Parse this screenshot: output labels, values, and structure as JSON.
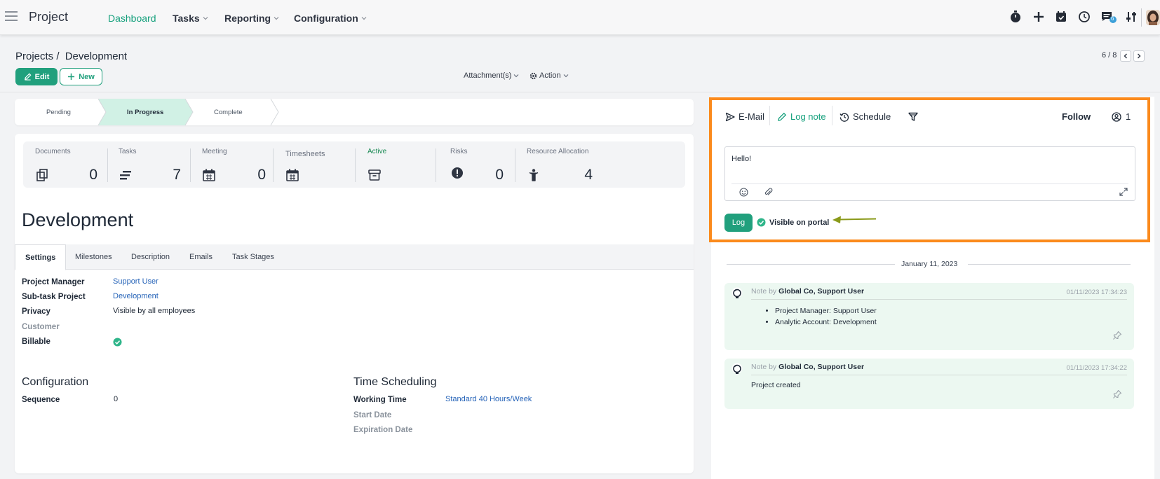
{
  "navbar": {
    "app_title": "Project",
    "menus": [
      "Dashboard",
      "Tasks",
      "Reporting",
      "Configuration"
    ],
    "messages_badge": "6"
  },
  "control_panel": {
    "breadcrumb_parent": "Projects",
    "breadcrumb_sep": "/",
    "breadcrumb_current": "Development",
    "edit_label": "Edit",
    "new_label": "New",
    "attachments_label": "Attachment(s)",
    "action_label": "Action",
    "pager": "6 / 8"
  },
  "status_bar": {
    "stages": [
      "Pending",
      "In Progress",
      "Complete"
    ],
    "active_stage": "In Progress"
  },
  "stats": [
    {
      "label": "Documents",
      "value": "0",
      "icon": "documents-icon"
    },
    {
      "label": "Tasks",
      "value": "7",
      "icon": "tasks-icon"
    },
    {
      "label": "Meeting",
      "value": "0",
      "icon": "calendar-icon"
    },
    {
      "label": "Timesheets",
      "value": "",
      "icon": "calendar-icon"
    },
    {
      "label": "Active",
      "value": "",
      "icon": "archive-icon"
    },
    {
      "label": "Risks",
      "value": "0",
      "icon": "risk-icon"
    },
    {
      "label": "Resource Allocation",
      "value": "4",
      "icon": "person-icon"
    }
  ],
  "record_title": "Development",
  "tabs": [
    "Settings",
    "Milestones",
    "Description",
    "Emails",
    "Task Stages"
  ],
  "settings": {
    "project_manager_label": "Project Manager",
    "project_manager_value": "Support User",
    "subtask_label": "Sub-task Project",
    "subtask_value": "Development",
    "privacy_label": "Privacy",
    "privacy_value": "Visible by all employees",
    "customer_label": "Customer",
    "billable_label": "Billable",
    "billable_checked": true
  },
  "configuration": {
    "title": "Configuration",
    "sequence_label": "Sequence",
    "sequence_value": "0"
  },
  "time_scheduling": {
    "title": "Time Scheduling",
    "working_time_label": "Working Time",
    "working_time_value": "Standard 40 Hours/Week",
    "start_date_label": "Start Date",
    "expiration_date_label": "Expiration Date"
  },
  "chatter": {
    "email_label": "E-Mail",
    "log_note_label": "Log note",
    "schedule_label": "Schedule",
    "follow_label": "Follow",
    "followers_count": "1",
    "composer_text": "Hello!",
    "log_button": "Log",
    "visible_portal_label": "Visible on portal",
    "date_separator": "January 11, 2023",
    "messages": [
      {
        "prefix": "Note by",
        "author": "Global Co, Support User",
        "date": "01/11/2023 17:34:23",
        "items": [
          "Project Manager: Support User",
          "Analytic Account: Development"
        ]
      },
      {
        "prefix": "Note by",
        "author": "Global Co, Support User",
        "date": "01/11/2023 17:34:22",
        "body": "Project created"
      }
    ]
  },
  "colors": {
    "brand": "#21a07d",
    "highlight": "#fb8a1c",
    "arrow": "#8a9a1a",
    "link": "#2563b8"
  }
}
